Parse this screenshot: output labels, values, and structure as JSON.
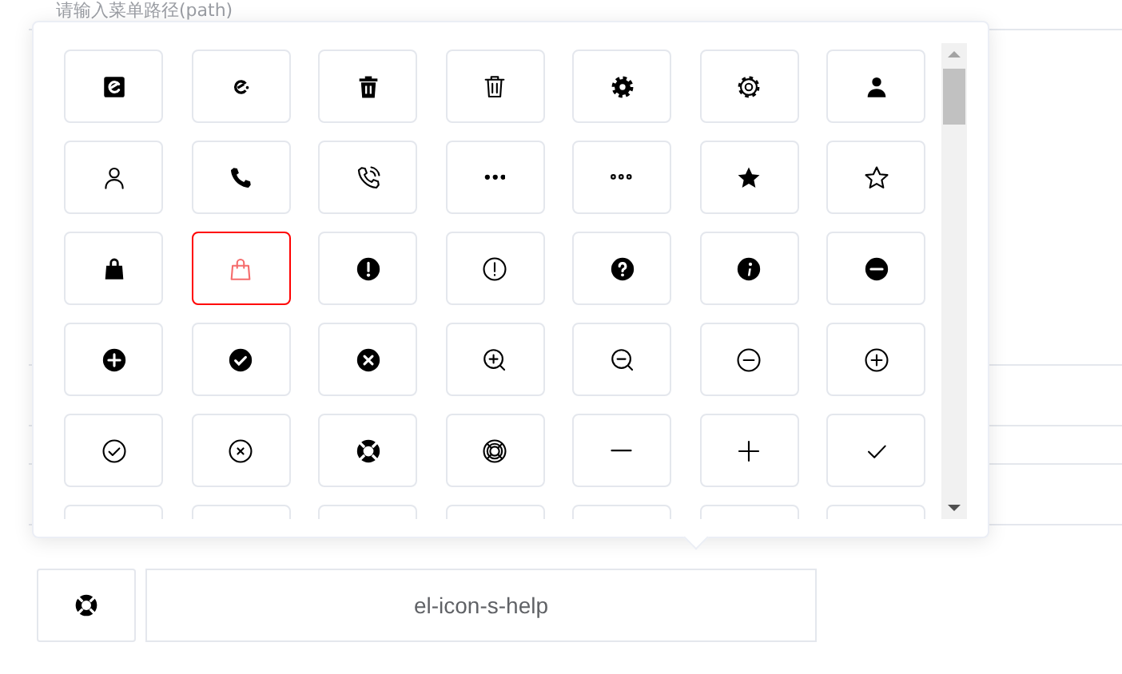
{
  "path_field": {
    "placeholder": "请输入菜单路径(path)"
  },
  "icon_picker": {
    "icons": [
      {
        "kind": "eleme-filled",
        "selected": false
      },
      {
        "kind": "eleme",
        "selected": false
      },
      {
        "kind": "delete-solid",
        "selected": false
      },
      {
        "kind": "delete",
        "selected": false
      },
      {
        "kind": "setting-solid",
        "selected": false
      },
      {
        "kind": "setting",
        "selected": false
      },
      {
        "kind": "user-solid",
        "selected": false
      },
      {
        "kind": "user",
        "selected": false
      },
      {
        "kind": "phone-solid",
        "selected": false
      },
      {
        "kind": "phone-outline",
        "selected": false
      },
      {
        "kind": "more-solid",
        "selected": false
      },
      {
        "kind": "more",
        "selected": false
      },
      {
        "kind": "star-on",
        "selected": false
      },
      {
        "kind": "star-off",
        "selected": false
      },
      {
        "kind": "goods-solid",
        "selected": false
      },
      {
        "kind": "goods",
        "selected": true
      },
      {
        "kind": "warning",
        "selected": false
      },
      {
        "kind": "warning-outline",
        "selected": false
      },
      {
        "kind": "question",
        "selected": false
      },
      {
        "kind": "info",
        "selected": false
      },
      {
        "kind": "remove",
        "selected": false
      },
      {
        "kind": "circle-plus",
        "selected": false
      },
      {
        "kind": "success",
        "selected": false
      },
      {
        "kind": "error",
        "selected": false
      },
      {
        "kind": "zoom-in",
        "selected": false
      },
      {
        "kind": "zoom-out",
        "selected": false
      },
      {
        "kind": "remove-outline",
        "selected": false
      },
      {
        "kind": "circle-plus-outline",
        "selected": false
      },
      {
        "kind": "circle-check",
        "selected": false
      },
      {
        "kind": "circle-close",
        "selected": false
      },
      {
        "kind": "help",
        "selected": false
      },
      {
        "kind": "help-outline",
        "selected": false
      },
      {
        "kind": "minus",
        "selected": false
      },
      {
        "kind": "plus",
        "selected": false
      },
      {
        "kind": "check",
        "selected": false
      },
      {
        "kind": "hidden",
        "selected": false
      },
      {
        "kind": "hidden",
        "selected": false
      },
      {
        "kind": "hidden",
        "selected": false
      },
      {
        "kind": "hidden",
        "selected": false
      },
      {
        "kind": "hidden",
        "selected": false
      },
      {
        "kind": "hidden",
        "selected": false
      },
      {
        "kind": "hidden",
        "selected": false
      }
    ]
  },
  "icon_field": {
    "preview": {
      "kind": "help"
    },
    "value": "el-icon-s-help"
  }
}
